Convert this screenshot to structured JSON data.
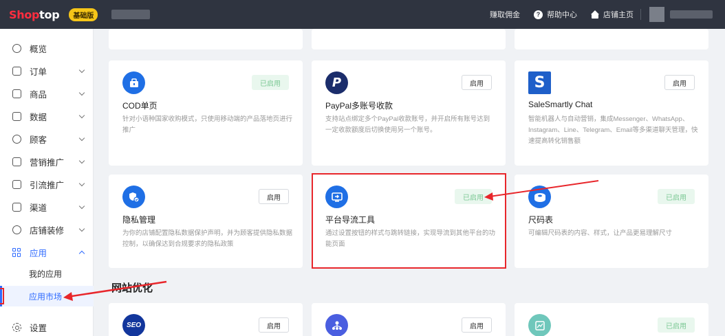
{
  "topbar": {
    "logo_part1": "Shop",
    "logo_part2": "top",
    "edition": "基础版",
    "links": {
      "earn": "赚取佣金",
      "help": "帮助中心",
      "store_home": "店铺主页"
    },
    "help_glyph": "?"
  },
  "sidebar": {
    "items": {
      "overview": "概览",
      "orders": "订单",
      "products": "商品",
      "data": "数据",
      "customers": "顾客",
      "marketing": "营销推广",
      "traffic": "引流推广",
      "channels": "渠道",
      "store_design": "店铺装修",
      "apps": "应用",
      "my_apps": "我的应用",
      "app_market": "应用市场",
      "settings": "设置"
    }
  },
  "apps": [
    {
      "title": "COD单页",
      "desc": "针对小语种国家收购模式，只使用移动端的产品落地页进行推广",
      "button": "已启用",
      "enabled": true,
      "icon_color": "#1f6fe5"
    },
    {
      "title": "PayPal多账号收款",
      "desc": "支持站点绑定多个PayPal收款账号，并开启所有账号达到一定收款额度后切换使用另一个账号。",
      "button": "启用",
      "enabled": false,
      "icon_color": "#1b2d6b",
      "icon_glyph": "P"
    },
    {
      "title": "SaleSmartly Chat",
      "desc": "智能机器人与自动营销，集成Messenger、WhatsApp、Instagram、Line、Telegram、Email等多渠道聊天管理，快速提高转化销售额",
      "button": "启用",
      "enabled": false,
      "icon_color": "#1e5fc9",
      "icon_glyph": "S"
    },
    {
      "title": "隐私管理",
      "desc": "为你的店铺配置隐私数据保护声明，并为顾客提供隐私数据控制，以确保达到合规要求的隐私政策",
      "button": "启用",
      "enabled": false,
      "icon_color": "#1f6fe5"
    },
    {
      "title": "平台导流工具",
      "desc": "通过设置按钮的样式与跳转链接，实现导流到其他平台的功能页面",
      "button": "已启用",
      "enabled": true,
      "icon_color": "#1f6fe5"
    },
    {
      "title": "尺码表",
      "desc": "可编辑尺码表的内容、样式，让产品更易理解尺寸",
      "button": "已启用",
      "enabled": true,
      "icon_color": "#1f6fe5"
    }
  ],
  "section": {
    "title": "网站优化"
  },
  "bottom_apps": [
    {
      "button": "启用",
      "enabled": false,
      "icon_color": "#12369c",
      "icon_glyph": "SEO"
    },
    {
      "button": "启用",
      "enabled": false,
      "icon_color": "#4a5ee0"
    },
    {
      "button": "已启用",
      "enabled": true,
      "icon_color": "#6fc7bb"
    }
  ],
  "colors": {
    "accent": "#2f6bff",
    "annotation": "#e8262b",
    "topbar": "#2f3440",
    "enabled_bg": "#e9f7ee",
    "enabled_text": "#7bc894"
  }
}
